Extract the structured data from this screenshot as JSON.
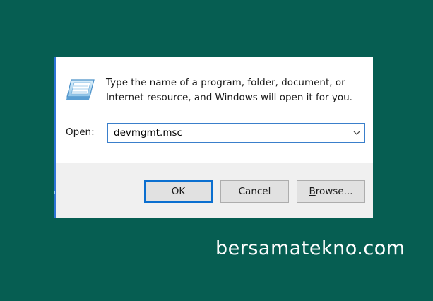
{
  "dialog": {
    "description_line1": "Type the name of a program, folder, document, or",
    "description_line2": "Internet resource, and Windows will open it for you.",
    "open_label_mnemonic": "O",
    "open_label_rest": "pen:",
    "open_value": "devmgmt.msc",
    "ok_label": "OK",
    "cancel_label": "Cancel",
    "browse_label_mnemonic": "B",
    "browse_label_rest": "rowse...",
    "icon": "run-app-icon",
    "dropdown_icon": "chevron-down-icon"
  },
  "watermark": "bersamatekno.com",
  "colors": {
    "desktop_background": "#065e52",
    "dialog_background": "#ffffff",
    "footer_background": "#f0f0f0",
    "focus_accent": "#0b6fd0"
  }
}
